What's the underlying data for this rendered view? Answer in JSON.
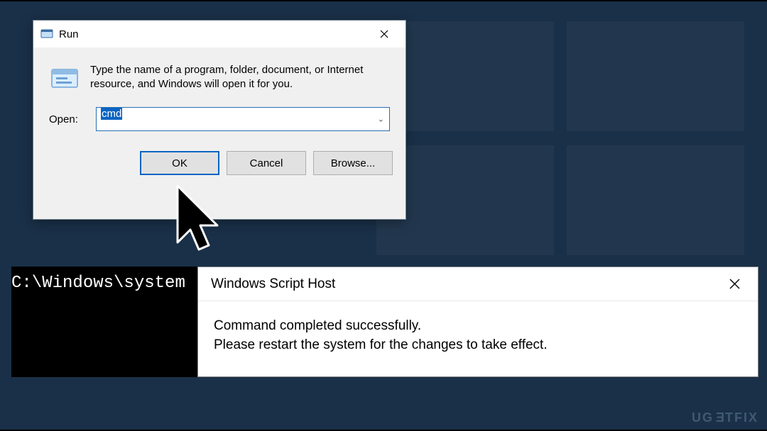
{
  "run_dialog": {
    "title": "Run",
    "description": "Type the name of a program, folder, document, or Internet resource, and Windows will open it for you.",
    "open_label": "Open:",
    "input_value": "cmd",
    "buttons": {
      "ok": "OK",
      "cancel": "Cancel",
      "browse": "Browse..."
    }
  },
  "cmd_window": {
    "prompt": "C:\\Windows\\system"
  },
  "wsh_dialog": {
    "title": "Windows Script Host",
    "message_line1": "Command completed successfully.",
    "message_line2": "Please restart the system for the changes to take effect."
  },
  "watermark": "UGETFIX"
}
